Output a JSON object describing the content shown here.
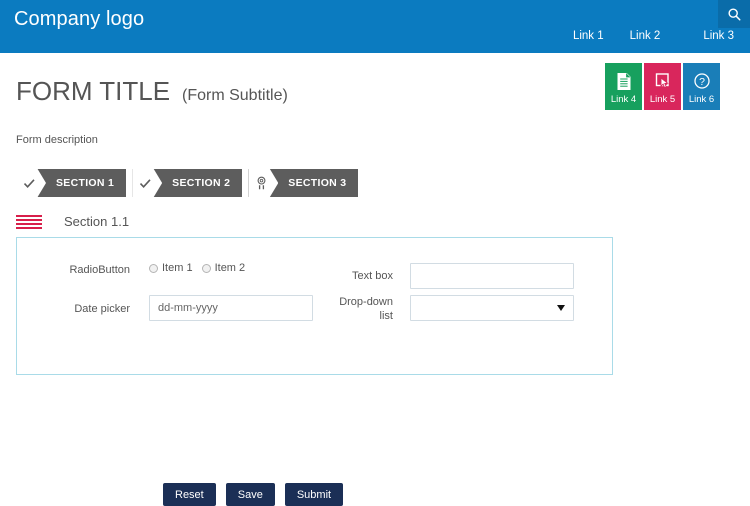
{
  "header": {
    "logo": "Company logo",
    "search_icon": "search-icon",
    "links": [
      {
        "label": "Link 1"
      },
      {
        "label": "Link 2"
      },
      {
        "label": "Link 3"
      }
    ],
    "background_color": "#0b7bc0",
    "search_background_color": "#0a6ca9"
  },
  "title_area": {
    "title": "FORM TITLE",
    "subtitle": "(Form Subtitle)",
    "description": "Form description"
  },
  "tiles": [
    {
      "label": "Link 4",
      "icon": "document-icon",
      "color": "#17a05e"
    },
    {
      "label": "Link 5",
      "icon": "click-pointer-icon",
      "color": "#d9265c"
    },
    {
      "label": "Link 6",
      "icon": "question-mark-icon",
      "color": "#1a7eb8"
    }
  ],
  "sections": [
    {
      "label": "SECTION 1",
      "icon": "check-icon"
    },
    {
      "label": "SECTION 2",
      "icon": "check-icon"
    },
    {
      "label": "SECTION 3",
      "icon": "award-ribbon-icon"
    }
  ],
  "subsection": {
    "menu_icon": "hamburger-icon",
    "title": "Section 1.1",
    "accent_color": "#d81f4a",
    "panel_border_color": "#a9dbe8"
  },
  "fields": {
    "radio": {
      "label": "RadioButton",
      "options": [
        {
          "label": "Item 1",
          "selected": false
        },
        {
          "label": "Item 2",
          "selected": false
        }
      ]
    },
    "date_picker": {
      "label": "Date picker",
      "value": "",
      "placeholder": "dd-mm-yyyy"
    },
    "text_box": {
      "label": "Text box",
      "value": "",
      "placeholder": ""
    },
    "dropdown": {
      "label": "Drop-down list",
      "selected": "",
      "arrow_icon": "chevron-down-icon"
    }
  },
  "actions": [
    {
      "label": "Reset"
    },
    {
      "label": "Save"
    },
    {
      "label": "Submit"
    }
  ]
}
